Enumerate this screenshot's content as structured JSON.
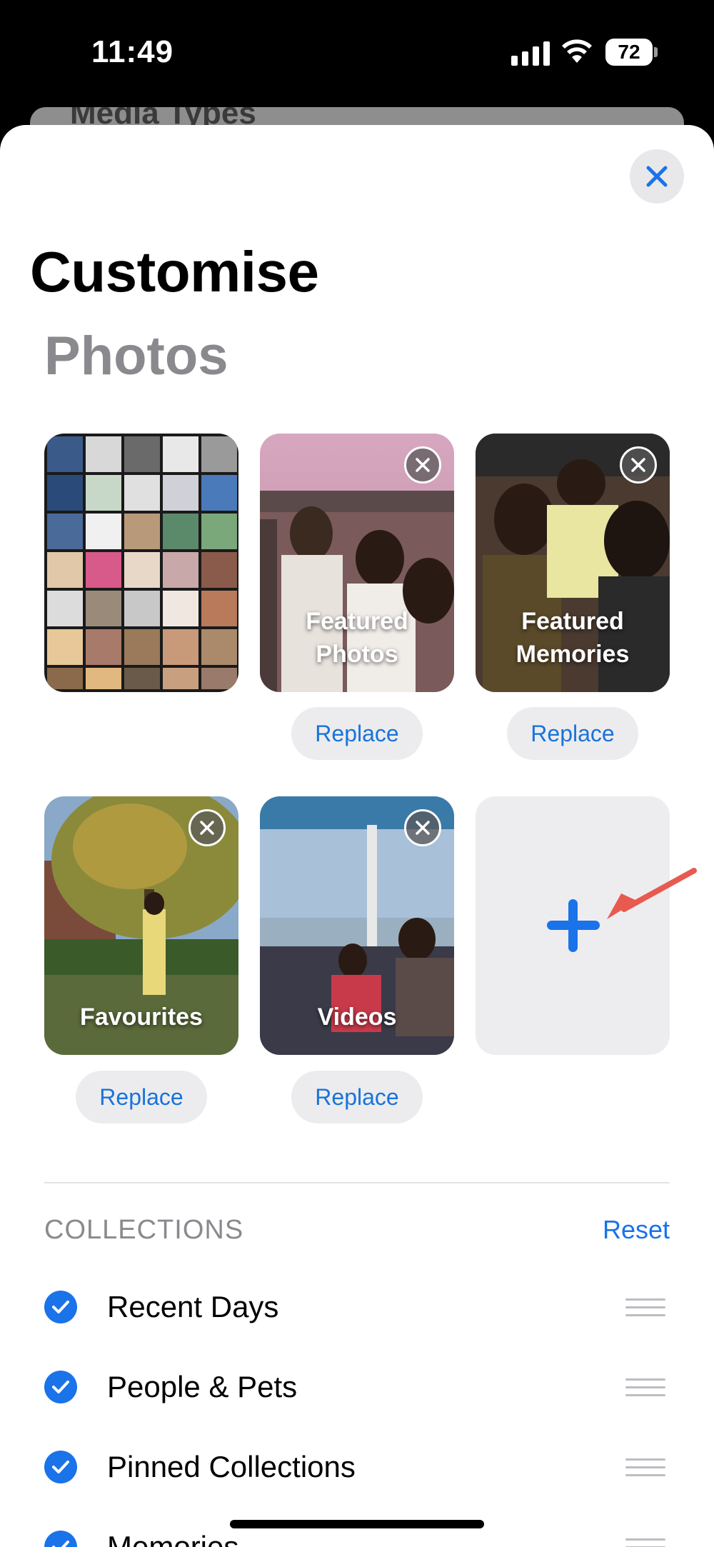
{
  "status": {
    "time": "11:49",
    "battery": "72"
  },
  "background_sheet": {
    "title": "Media Types"
  },
  "sheet": {
    "title": "Customise",
    "subtitle": "Photos"
  },
  "tiles": [
    {
      "label": ""
    },
    {
      "label": "Featured Photos",
      "replace": "Replace"
    },
    {
      "label": "Featured Memories",
      "replace": "Replace"
    },
    {
      "label": "Favourites",
      "replace": "Replace"
    },
    {
      "label": "Videos",
      "replace": "Replace"
    }
  ],
  "collections": {
    "heading": "COLLECTIONS",
    "reset": "Reset",
    "items": [
      {
        "label": "Recent Days"
      },
      {
        "label": "People & Pets"
      },
      {
        "label": "Pinned Collections"
      },
      {
        "label": "Memories"
      }
    ]
  },
  "colors": {
    "accent": "#1a73e8",
    "arrow": "#e85a4f"
  },
  "icons": [
    "close-icon",
    "remove-icon",
    "plus-icon",
    "checkmark-icon",
    "drag-handle-icon",
    "arrow-annotation"
  ]
}
